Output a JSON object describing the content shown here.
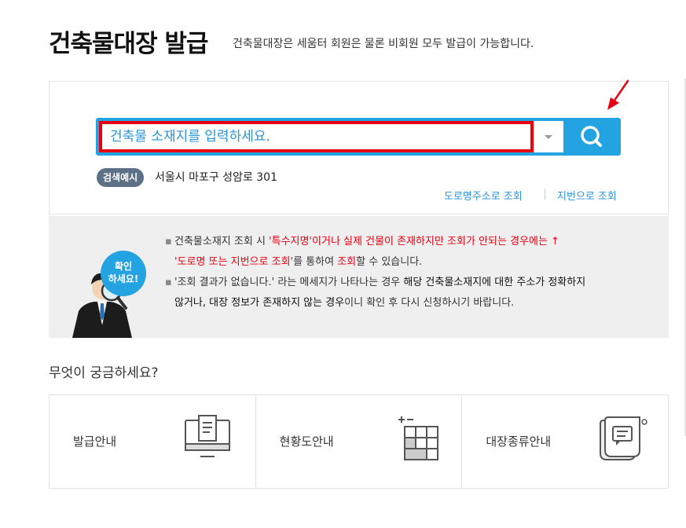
{
  "header": {
    "title": "건축물대장 발급",
    "subtitle": "건축물대장은 세움터 회원은 물론 비회원 모두 발급이 가능합니다."
  },
  "search": {
    "placeholder": "건축물 소재지를 입력하세요.",
    "button_icon": "search-icon",
    "example_badge": "검색예시",
    "example_text": "서울시 마포구 성암로 301",
    "link_road": "도로명주소로 조회",
    "link_jibun": "지번으로 조회"
  },
  "notice": {
    "bubble_line1": "확인",
    "bubble_line2": "하세요!",
    "bullet": "▪",
    "item1": {
      "p1": "건축물소재지 조회 시 ",
      "p2": "'특수지명'이거나 실제 건물이 존재하지만 조회가 안되는 경우에는 ↑",
      "p3": "'도로명 또는 지번으로 조회'",
      "p4": "를 통하여 ",
      "p5": "조회",
      "p6": "할 수 있습니다."
    },
    "item2": {
      "p1": "'조회 결과가 없습니다.' 라는 메세지가 나타나는 경우 ",
      "p2": "해당 건축물소재지에 대한 주소가 정확하지",
      "p3": "않거나, 대장 정보가 존재하지 않는 경우",
      "p4": "이니 확인 후 다시 신청하시기 바랍니다."
    }
  },
  "faq": {
    "title": "무엇이 궁금하세요?",
    "cards": [
      {
        "label": "발급안내",
        "icon": "monitor-document-icon"
      },
      {
        "label": "현황도안내",
        "icon": "floor-plan-grid-icon"
      },
      {
        "label": "대장종류안내",
        "icon": "scroll-document-icon"
      }
    ]
  },
  "colors": {
    "accent": "#24a3e3",
    "highlight": "#e60012",
    "badge": "#5d7186",
    "notice_bg": "#efefef"
  }
}
